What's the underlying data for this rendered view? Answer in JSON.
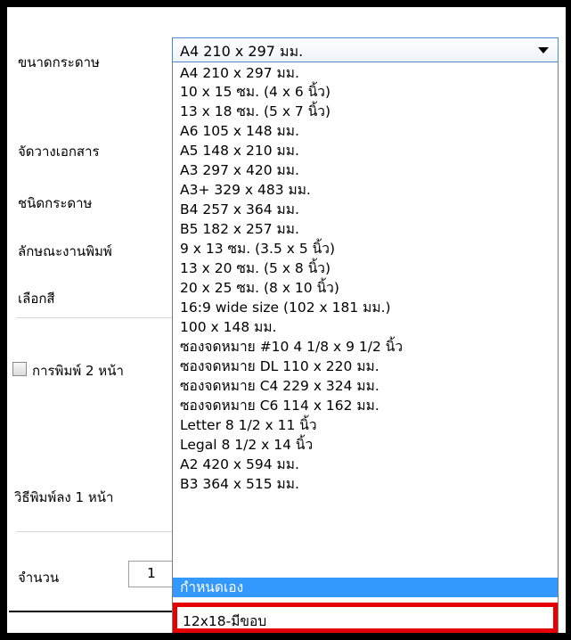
{
  "labels": {
    "paper_size": "ขนาดกระดาษ",
    "layout": "จัดวางเอกสาร",
    "paper_type": "ชนิดกระดาษ",
    "print_quality": "ลักษณะงานพิมพ์",
    "color": "เลือกสี",
    "duplex": "การพิมพ์ 2 หน้า",
    "pages_per_sheet": "วิธีพิมพ์ลง 1 หน้า",
    "copies": "จำนวน"
  },
  "paper_size_select": {
    "value": "A4 210 x 297 มม."
  },
  "paper_size_options": [
    "A4 210 x 297 มม.",
    "10 x 15 ซม. (4 x 6 นิ้ว)",
    "13 x 18 ซม. (5 x 7 นิ้ว)",
    "A6 105 x 148 มม.",
    "A5 148 x 210 มม.",
    "A3 297 x 420 มม.",
    "A3+ 329 x 483 มม.",
    "B4 257 x 364 มม.",
    "B5 182 x 257 มม.",
    "9 x 13 ซม. (3.5 x 5 นิ้ว)",
    "13 x 20 ซม. (5 x 8 นิ้ว)",
    "20 x 25 ซม. (8 x 10 นิ้ว)",
    "16:9 wide size (102 x 181 มม.)",
    "100 x 148 มม.",
    "ซองจดหมาย #10 4 1/8 x 9 1/2 นิ้ว",
    "ซองจดหมาย DL  110 x 220 มม.",
    "ซองจดหมาย C4  229 x 324 มม.",
    "ซองจดหมาย C6  114 x 162 มม.",
    "Letter 8 1/2 x 11 นิ้ว",
    "Legal 8 1/2 x 14 นิ้ว",
    "A2 420 x 594 มม.",
    "B3 364 x 515 มม."
  ],
  "highlighted_option": "กำหนดเอง",
  "custom_option": "12x18-มีขอบ",
  "copies_value": "1",
  "colors": {
    "selection": "#3399ff",
    "annotation_box": "#e40000"
  }
}
